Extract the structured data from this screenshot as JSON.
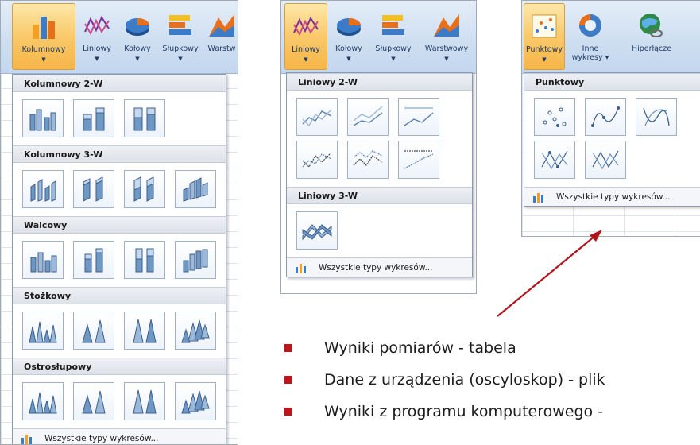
{
  "panel1": {
    "ribbon": [
      {
        "label": "Kolumnowy",
        "icon": "column-chart-icon",
        "active": true
      },
      {
        "label": "Liniowy",
        "icon": "line-chart-icon"
      },
      {
        "label": "Kołowy",
        "icon": "pie-chart-icon"
      },
      {
        "label": "Słupkowy",
        "icon": "bar-chart-icon"
      },
      {
        "label": "Warstw",
        "icon": "area-chart-icon"
      }
    ],
    "sections": [
      {
        "title": "Kolumnowy 2-W",
        "count": 3,
        "icon": "column2d-icon"
      },
      {
        "title": "Kolumnowy 3-W",
        "count": 4,
        "icon": "column3d-icon"
      },
      {
        "title": "Walcowy",
        "count": 4,
        "icon": "cylinder-icon"
      },
      {
        "title": "Stożkowy",
        "count": 4,
        "icon": "cone-icon"
      },
      {
        "title": "Ostrosłupowy",
        "count": 4,
        "icon": "pyramid-icon"
      }
    ],
    "footer": "Wszystkie typy wykresów..."
  },
  "panel2": {
    "ribbon": [
      {
        "label": "Liniowy",
        "icon": "line-chart-icon",
        "active": true
      },
      {
        "label": "Kołowy",
        "icon": "pie-chart-icon"
      },
      {
        "label": "Słupkowy",
        "icon": "bar-chart-icon"
      },
      {
        "label": "Warstwowy",
        "icon": "area-chart-icon"
      }
    ],
    "sections": [
      {
        "title": "Liniowy 2-W",
        "count": 6,
        "icon": "line2d-icon"
      },
      {
        "title": "Liniowy 3-W",
        "count": 1,
        "icon": "line3d-icon"
      }
    ],
    "footer": "Wszystkie typy wykresów..."
  },
  "panel3": {
    "ribbon": [
      {
        "label": "Punktowy",
        "icon": "scatter-chart-icon",
        "active": true
      },
      {
        "label": "Inne",
        "label2": "wykresy",
        "icon": "donut-chart-icon"
      },
      {
        "label": "Hiperłącze",
        "icon": "hyperlink-globe-icon"
      }
    ],
    "sections": [
      {
        "title": "Punktowy",
        "count": 5,
        "icon": "scatter-icon"
      }
    ],
    "footer": "Wszystkie typy wykresów..."
  },
  "bullets": [
    "Wyniki pomiarów - tabela",
    "Dane z urządzenia (oscyloskop) - plik",
    "Wyniki z programu komputerowego -"
  ],
  "colors": {
    "accent": "#c0141b",
    "ribbon": "#cfdff1",
    "active": "#f9c96a"
  }
}
